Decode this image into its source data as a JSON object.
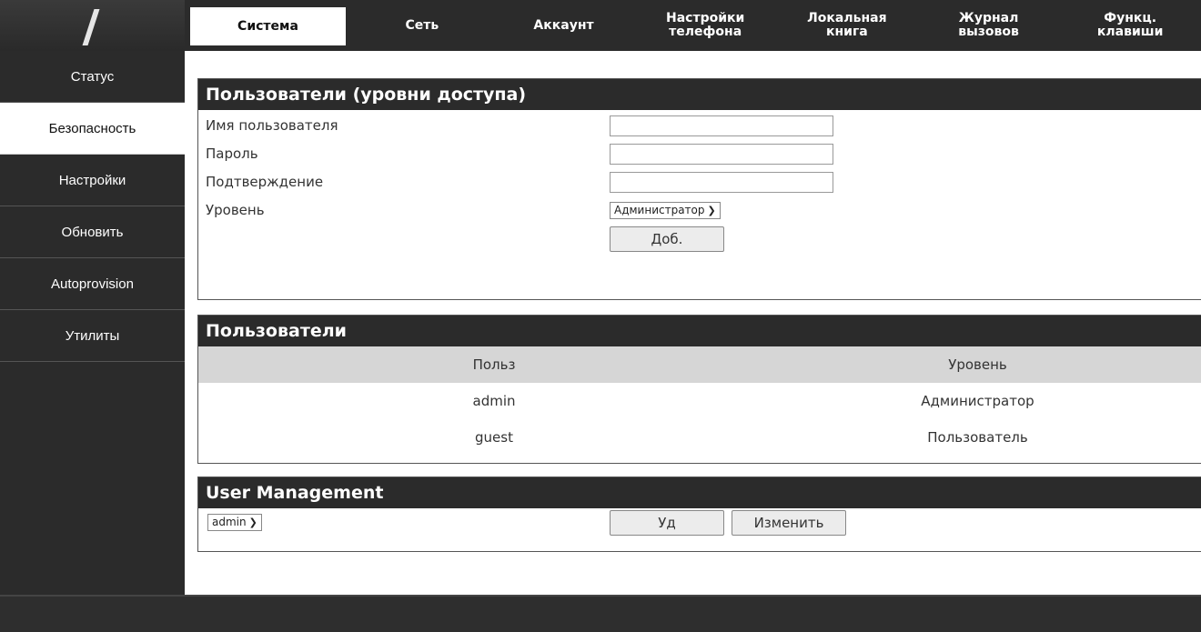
{
  "top_tabs": [
    "Система",
    "Сеть",
    "Аккаунт",
    "Настройки\nтелефона",
    "Локальная\nкнига",
    "Журнал\nвызовов",
    "Функц.\nклавиши"
  ],
  "sidebar": [
    "Статус",
    "Безопасность",
    "Настройки",
    "Обновить",
    "Autoprovision",
    "Утилиты"
  ],
  "access_panel": {
    "title": "Пользователи (уровни доступа)",
    "username_label": "Имя пользователя",
    "username_value": "",
    "password_label": "Пароль",
    "password_value": "",
    "confirm_label": "Подтверждение",
    "confirm_value": "",
    "level_label": "Уровень",
    "level_selected": "Администратор",
    "add_button": "Доб."
  },
  "users_panel": {
    "title": "Пользователи",
    "col_user": "Польз",
    "col_level": "Уровень",
    "rows": [
      {
        "user": "admin",
        "level": "Администратор"
      },
      {
        "user": "guest",
        "level": "Пользователь"
      }
    ]
  },
  "management_panel": {
    "title": "User Management",
    "user_selected": "admin",
    "delete_button": "Уд",
    "edit_button": "Изменить"
  },
  "colors": {
    "dark": "#2b2b2b",
    "table_header": "#d6d6d6",
    "active": "#ffffff"
  }
}
